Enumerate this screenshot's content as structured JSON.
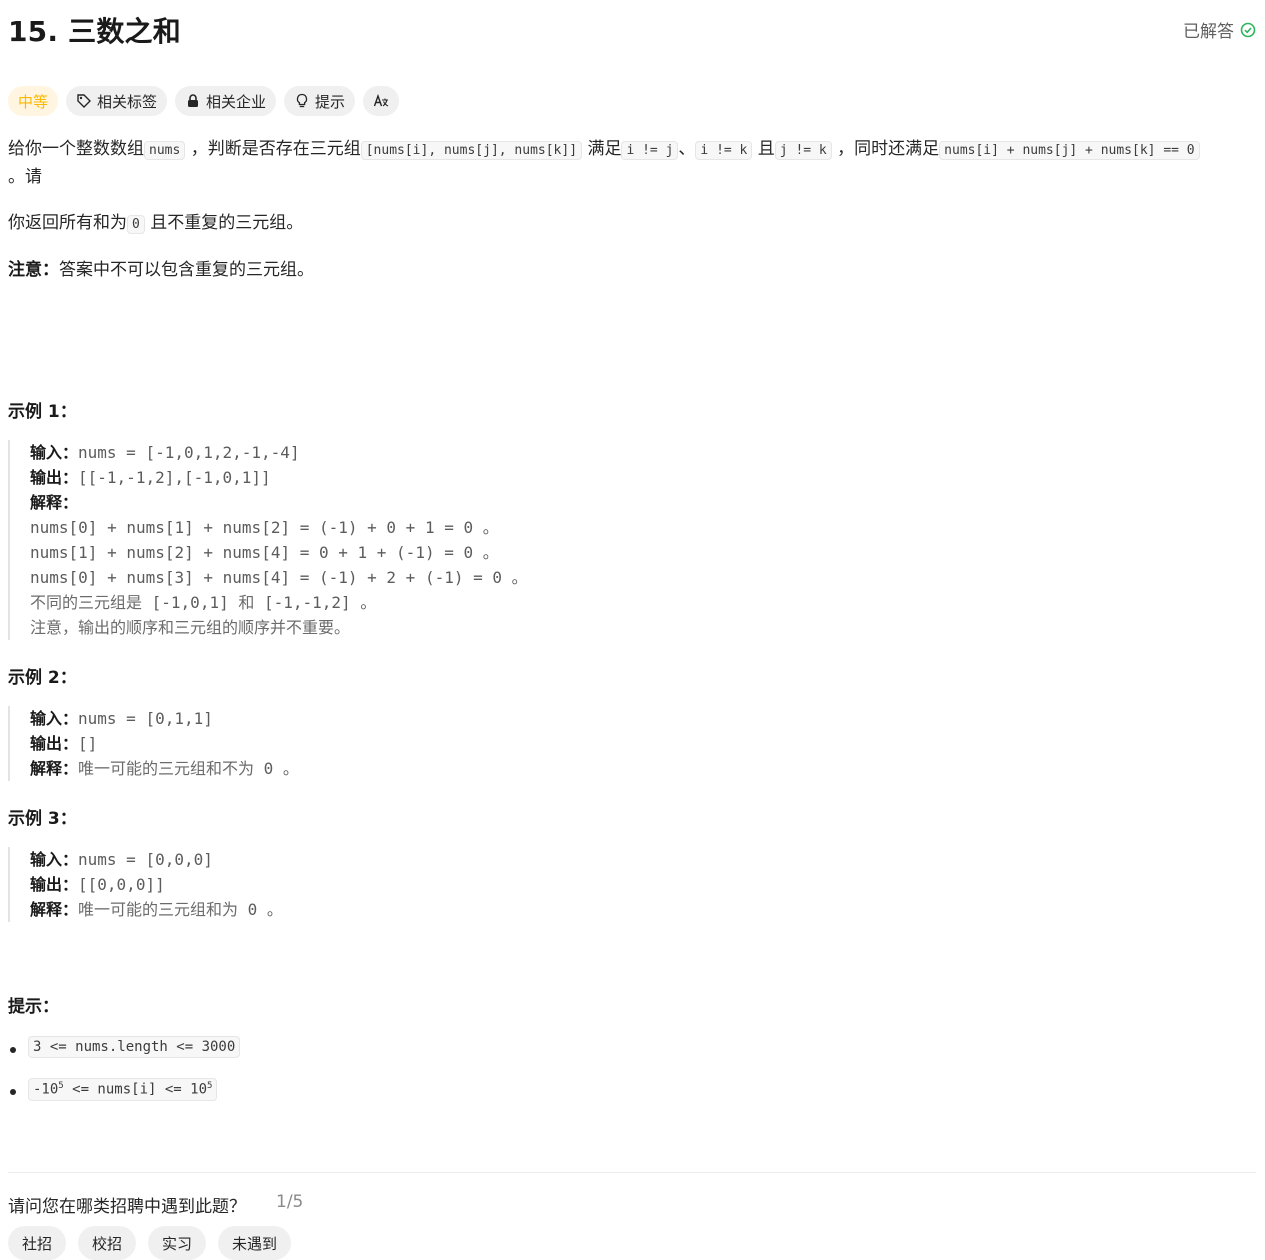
{
  "problem": {
    "title": "15. 三数之和",
    "status": "已解答"
  },
  "tags": {
    "difficulty": "中等",
    "related_tags": "相关标签",
    "related_companies": "相关企业",
    "hint": "提示",
    "translate": "A文"
  },
  "description": {
    "p1_a": "给你一个整数数组",
    "p1_code1": "nums",
    "p1_b": "，判断是否存在三元组",
    "p1_code2": "[nums[i], nums[j], nums[k]]",
    "p1_c": "满足",
    "p1_code3": "i != j",
    "p1_d": "、",
    "p1_code4": "i != k",
    "p1_e": "且",
    "p1_code5": "j != k",
    "p1_f": "，同时还满足",
    "p1_code6": "nums[i] + nums[j] + nums[k] == 0",
    "p1_g": "。请",
    "p2_a": "你返回所有和为",
    "p2_code": "0",
    "p2_b": "且不重复的三元组。",
    "p3_label": "注意：",
    "p3_text": "答案中不可以包含重复的三元组。"
  },
  "examples": [
    {
      "title": "示例 1：",
      "input_label": "输入：",
      "input": "nums = [-1,0,1,2,-1,-4]",
      "output_label": "输出：",
      "output": "[[-1,-1,2],[-1,0,1]]",
      "explain_label": "解释：",
      "lines": [
        "nums[0] + nums[1] + nums[2] = (-1) + 0 + 1 = 0 。",
        "nums[1] + nums[2] + nums[4] = 0 + 1 + (-1) = 0 。",
        "nums[0] + nums[3] + nums[4] = (-1) + 2 + (-1) = 0 。"
      ],
      "note1_a": "不同的三元组是",
      "note1_b": " [-1,0,1] ",
      "note1_c": "和",
      "note1_d": " [-1,-1,2] ",
      "note1_e": "。",
      "note2": "注意，输出的顺序和三元组的顺序并不重要。"
    },
    {
      "title": "示例 2：",
      "input_label": "输入：",
      "input": "nums = [0,1,1]",
      "output_label": "输出：",
      "output": "[]",
      "explain_label": "解释：",
      "explain": "唯一可能的三元组和不为",
      "explain_val": " 0 。"
    },
    {
      "title": "示例 3：",
      "input_label": "输入：",
      "input": "nums = [0,0,0]",
      "output_label": "输出：",
      "output": "[[0,0,0]]",
      "explain_label": "解释：",
      "explain": "唯一可能的三元组和为",
      "explain_val": " 0 。"
    }
  ],
  "hints": {
    "title": "提示：",
    "h1": "3 <= nums.length <= 3000",
    "h2_a": "-10",
    "h2_sup1": "5",
    "h2_b": " <= nums[i] <= 10",
    "h2_sup2": "5"
  },
  "survey": {
    "question": "请问您在哪类招聘中遇到此题？",
    "page": "1/5",
    "options": [
      "社招",
      "校招",
      "实习",
      "未遇到"
    ]
  },
  "colors": {
    "difficulty": "#ffb800",
    "solved_icon": "#2db55d"
  }
}
